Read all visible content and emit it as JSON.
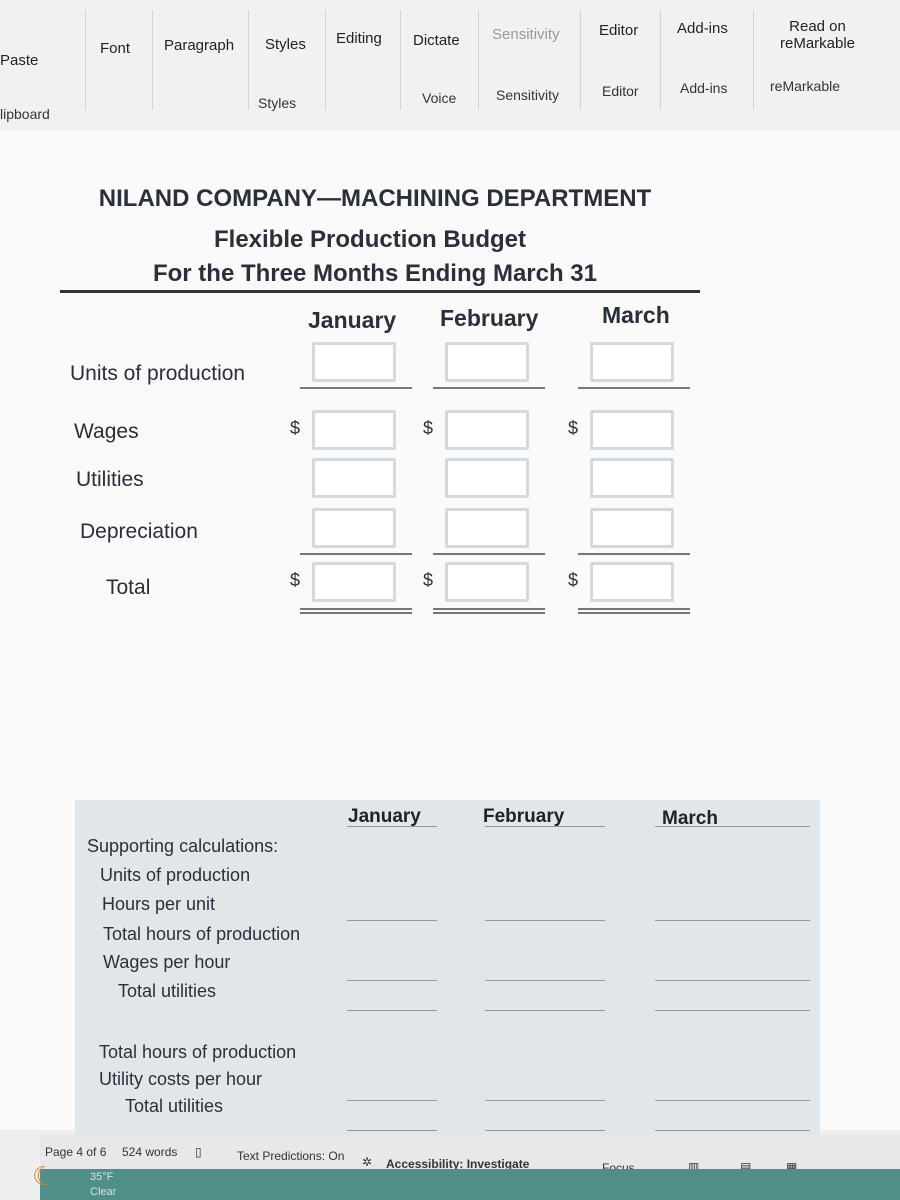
{
  "ribbon": {
    "groups": [
      {
        "label": "Paste"
      },
      {
        "label": "Font"
      },
      {
        "label": "Paragraph"
      },
      {
        "label": "Styles"
      },
      {
        "label": "Editing"
      },
      {
        "label": "Dictate"
      },
      {
        "label": "Sensitivity"
      },
      {
        "label": "Editor"
      },
      {
        "label": "Add-ins"
      },
      {
        "label": "Read on"
      },
      {
        "label": "reMarkable"
      }
    ],
    "group_labels": {
      "clipboard": "lipboard",
      "styles": "Styles",
      "voice": "Voice",
      "sensitivity": "Sensitivity",
      "editor": "Editor",
      "addins": "Add-ins",
      "remarkable": "reMarkable"
    }
  },
  "doc": {
    "title1": "NILAND COMPANY—MACHINING DEPARTMENT",
    "title2": "Flexible Production Budget",
    "title3": "For the Three Months Ending March 31",
    "months": [
      "January",
      "February",
      "March"
    ],
    "rows": [
      "Units of production",
      "Wages",
      "Utilities",
      "Depreciation",
      "Total"
    ],
    "currency": "$",
    "supporting": {
      "heading": "Supporting calculations:",
      "items": [
        "Units of production",
        "Hours per unit",
        "Total hours of production",
        "Wages per hour",
        "Total utilities",
        "Total hours of production",
        "Utility costs per hour",
        "Total utilities"
      ]
    }
  },
  "status": {
    "page": "Page 4 of 6",
    "words": "524 words",
    "predictions": "Text Predictions: On",
    "accessibility": "Accessibility: Investigate",
    "focus": "Focus"
  },
  "taskbar": {
    "temp": "35°F",
    "weather": "Clear"
  }
}
